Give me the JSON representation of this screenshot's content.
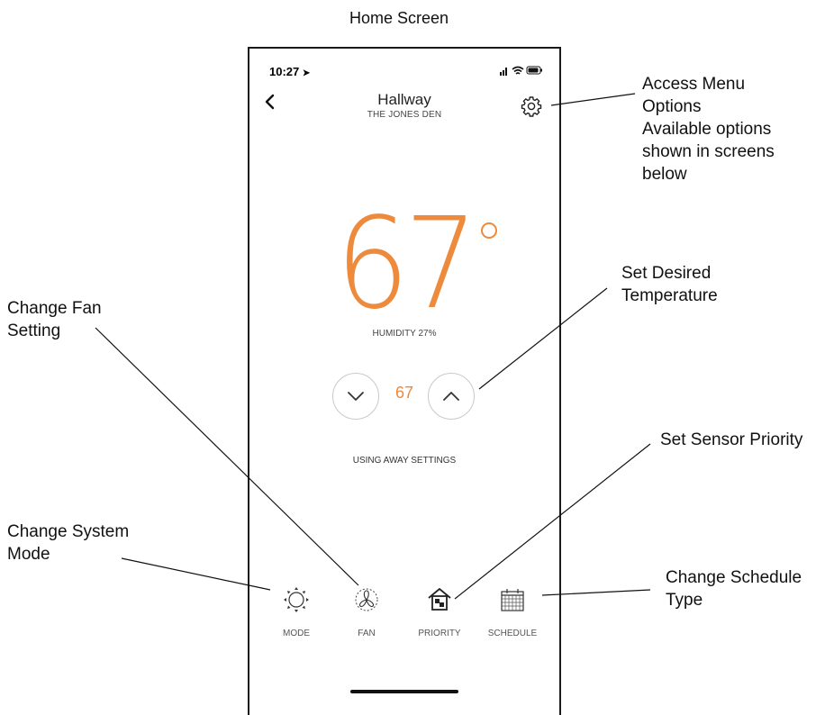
{
  "title": "Home Screen",
  "status_bar": {
    "time": "10:27",
    "icons": "signal wifi battery"
  },
  "header": {
    "room_name": "Hallway",
    "location": "THE JONES DEN"
  },
  "thermostat": {
    "current_temp": "67",
    "humidity": "HUMIDITY 27%",
    "setpoint": "67",
    "mode_status": "USING AWAY SETTINGS"
  },
  "bottom_nav": [
    {
      "label": "MODE",
      "icon": "sun-icon"
    },
    {
      "label": "FAN",
      "icon": "fan-icon"
    },
    {
      "label": "PRIORITY",
      "icon": "house-priority-icon"
    },
    {
      "label": "SCHEDULE",
      "icon": "calendar-icon"
    }
  ],
  "callouts": {
    "menu": [
      "Access Menu",
      "Options",
      "Available options",
      "shown in screens",
      "below"
    ],
    "temperature": [
      "Set Desired",
      "Temperature"
    ],
    "fan": [
      "Change Fan",
      "Setting"
    ],
    "sensor": [
      "Set Sensor Priority"
    ],
    "mode": [
      "Change System",
      "Mode"
    ],
    "schedule": [
      "Change Schedule",
      "Type"
    ]
  },
  "colors": {
    "accent": "#ee8a3c",
    "frame": "#1a1a1a"
  }
}
